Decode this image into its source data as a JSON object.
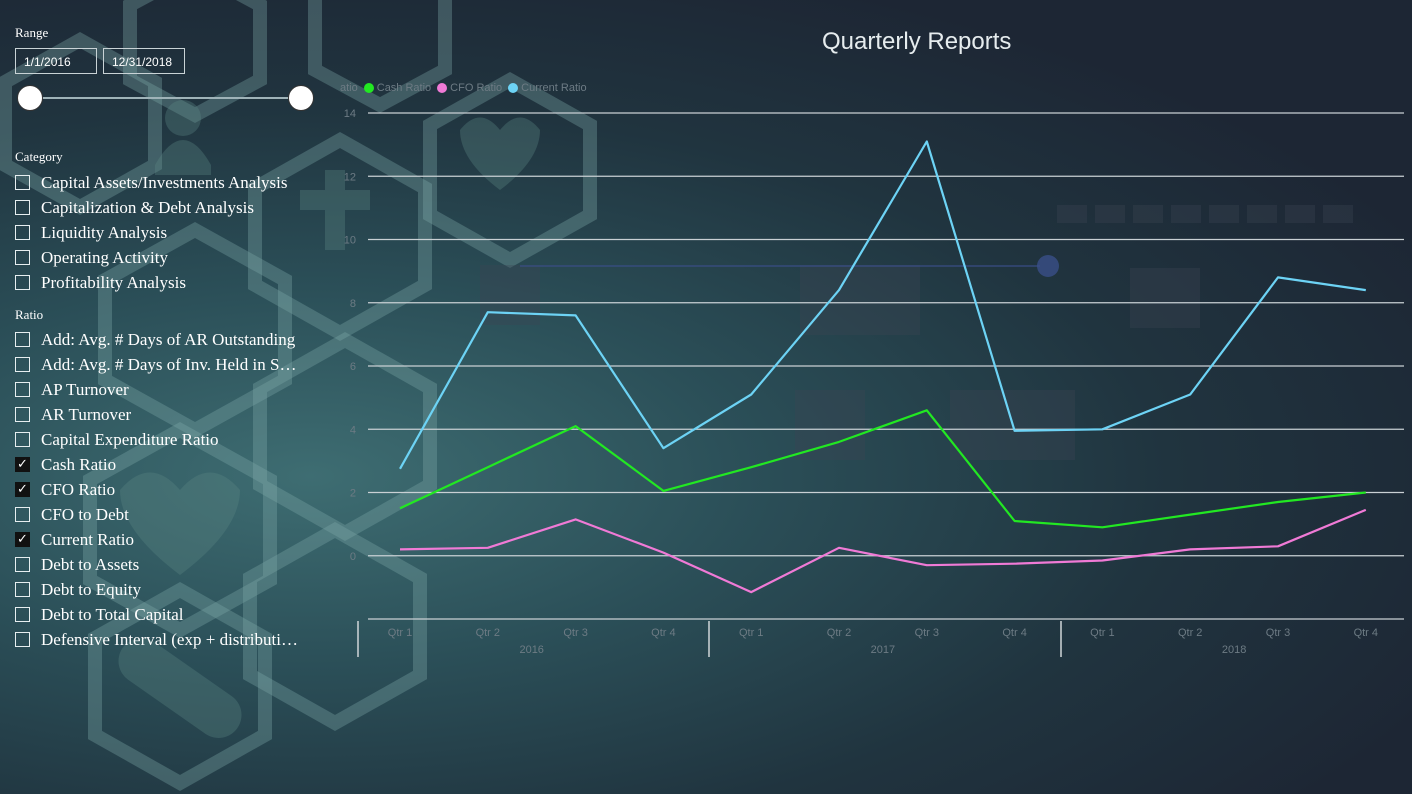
{
  "range": {
    "label": "Range",
    "start_date": "1/1/2016",
    "end_date": "12/31/2018"
  },
  "category": {
    "label": "Category",
    "items": [
      {
        "label": "Capital Assets/Investments Analysis",
        "checked": false
      },
      {
        "label": "Capitalization & Debt Analysis",
        "checked": false
      },
      {
        "label": "Liquidity Analysis",
        "checked": false
      },
      {
        "label": "Operating Activity",
        "checked": false
      },
      {
        "label": "Profitability Analysis",
        "checked": false
      }
    ]
  },
  "ratio": {
    "label": "Ratio",
    "items": [
      {
        "label": "Add: Avg. # Days of AR Outstanding",
        "checked": false
      },
      {
        "label": "Add: Avg. # Days of Inv. Held in S…",
        "checked": false
      },
      {
        "label": "AP Turnover",
        "checked": false
      },
      {
        "label": "AR Turnover",
        "checked": false
      },
      {
        "label": "Capital Expenditure Ratio",
        "checked": false
      },
      {
        "label": "Cash Ratio",
        "checked": true
      },
      {
        "label": "CFO Ratio",
        "checked": true
      },
      {
        "label": "CFO to Debt",
        "checked": false
      },
      {
        "label": "Current Ratio",
        "checked": true
      },
      {
        "label": "Debt to Assets",
        "checked": false
      },
      {
        "label": "Debt to Equity",
        "checked": false
      },
      {
        "label": "Debt to Total Capital",
        "checked": false
      },
      {
        "label": "Defensive Interval (exp + distributi…",
        "checked": false
      }
    ]
  },
  "checkmark_glyph": "✓",
  "chart_data": {
    "type": "line",
    "title": "Quarterly Reports",
    "legend_title": "atio",
    "legend_position": "top-left",
    "x": [
      "Qtr 1",
      "Qtr 2",
      "Qtr 3",
      "Qtr 4",
      "Qtr 1",
      "Qtr 2",
      "Qtr 3",
      "Qtr 4",
      "Qtr 1",
      "Qtr 2",
      "Qtr 3",
      "Qtr 4"
    ],
    "year_groups": [
      {
        "label": "2016",
        "count": 4
      },
      {
        "label": "2017",
        "count": 4
      },
      {
        "label": "2018",
        "count": 4
      }
    ],
    "yticks": [
      "14",
      "12",
      "10",
      "8",
      "6",
      "4",
      "2",
      "0"
    ],
    "ylim": [
      -2,
      14
    ],
    "grid": true,
    "series": [
      {
        "name": "Cash Ratio",
        "color": "#22e822",
        "values": [
          1.5,
          2.8,
          4.1,
          2.05,
          2.8,
          3.6,
          4.6,
          1.1,
          0.9,
          1.3,
          1.7,
          2.0
        ]
      },
      {
        "name": "CFO Ratio",
        "color": "#f07ad6",
        "values": [
          0.2,
          0.25,
          1.15,
          0.1,
          -1.15,
          0.25,
          -0.3,
          -0.25,
          -0.15,
          0.2,
          0.3,
          1.45
        ]
      },
      {
        "name": "Current Ratio",
        "color": "#6dd3f5",
        "values": [
          2.75,
          7.7,
          7.6,
          3.4,
          5.1,
          8.4,
          13.1,
          3.95,
          4.0,
          5.1,
          8.8,
          8.4
        ]
      }
    ]
  }
}
